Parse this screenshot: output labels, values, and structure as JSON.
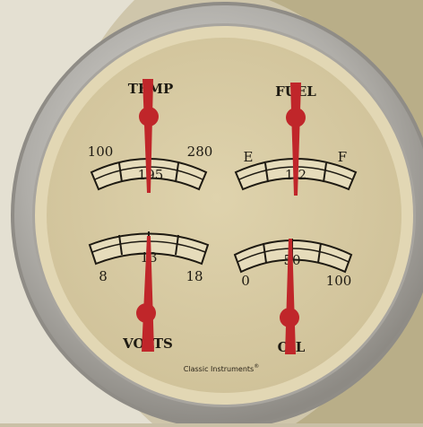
{
  "brand": {
    "name": "Classic Instruments",
    "mark": "®"
  },
  "gauges": {
    "temp": {
      "label": "TEMP",
      "min": "100",
      "mid": "195",
      "max": "280"
    },
    "fuel": {
      "label": "FUEL",
      "min": "E",
      "mid": "1/2",
      "max": "F"
    },
    "volts": {
      "label": "VOLTS",
      "min": "8",
      "mid": "13",
      "max": "18"
    },
    "oil": {
      "label": "OIL",
      "min": "0",
      "mid": "50",
      "max": "100"
    }
  },
  "colors": {
    "background": "#c9c0a6",
    "bezel": "#b6b3ad",
    "dial_face": "#d9cca6",
    "needle": "#c0262a",
    "ink": "#1e1a12"
  },
  "icons": [
    "gauge-bezel",
    "needle-icon"
  ]
}
